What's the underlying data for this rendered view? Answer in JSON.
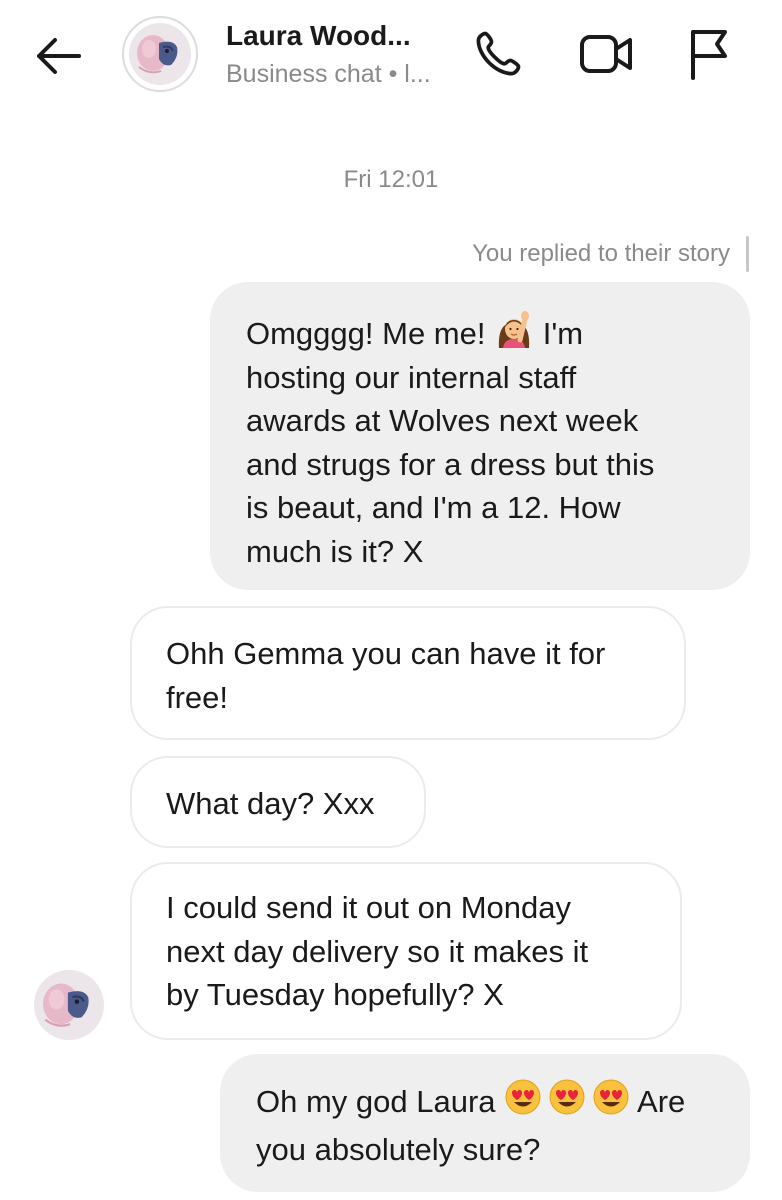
{
  "header": {
    "contact_name": "Laura Wood...",
    "subtitle": "Business chat • l...",
    "icons": {
      "back": "arrow-left-icon",
      "call": "phone-icon",
      "video": "video-camera-icon",
      "report": "flag-icon"
    }
  },
  "timestamp": "Fri 12:01",
  "story_note": "You replied to their story",
  "messages": [
    {
      "direction": "outgoing",
      "text_before_emoji": "Omgggg! Me me! ",
      "emoji": "woman-raising-hand-emoji",
      "text_after_emoji": " I'm\nhosting our internal staff\nawards at Wolves next week\nand strugs for a dress but this\nis beaut, and I'm a 12. How\nmuch is it? X"
    },
    {
      "direction": "incoming",
      "text": "Ohh Gemma you can have it for\nfree!"
    },
    {
      "direction": "incoming",
      "text": "What day? Xxx"
    },
    {
      "direction": "incoming",
      "text": "I could send it out on Monday\nnext day delivery so it makes it\nby Tuesday hopefully? X"
    },
    {
      "direction": "outgoing",
      "text_before_emoji": "Oh my god Laura ",
      "emoji": "smiling-face-with-heart-eyes-emoji",
      "text_after_emoji": " Are\nyou absolutely sure?"
    }
  ],
  "colors": {
    "outgoing_bubble": "#efefef",
    "incoming_border": "#ebebeb",
    "secondary_text": "#8a8a8a"
  }
}
